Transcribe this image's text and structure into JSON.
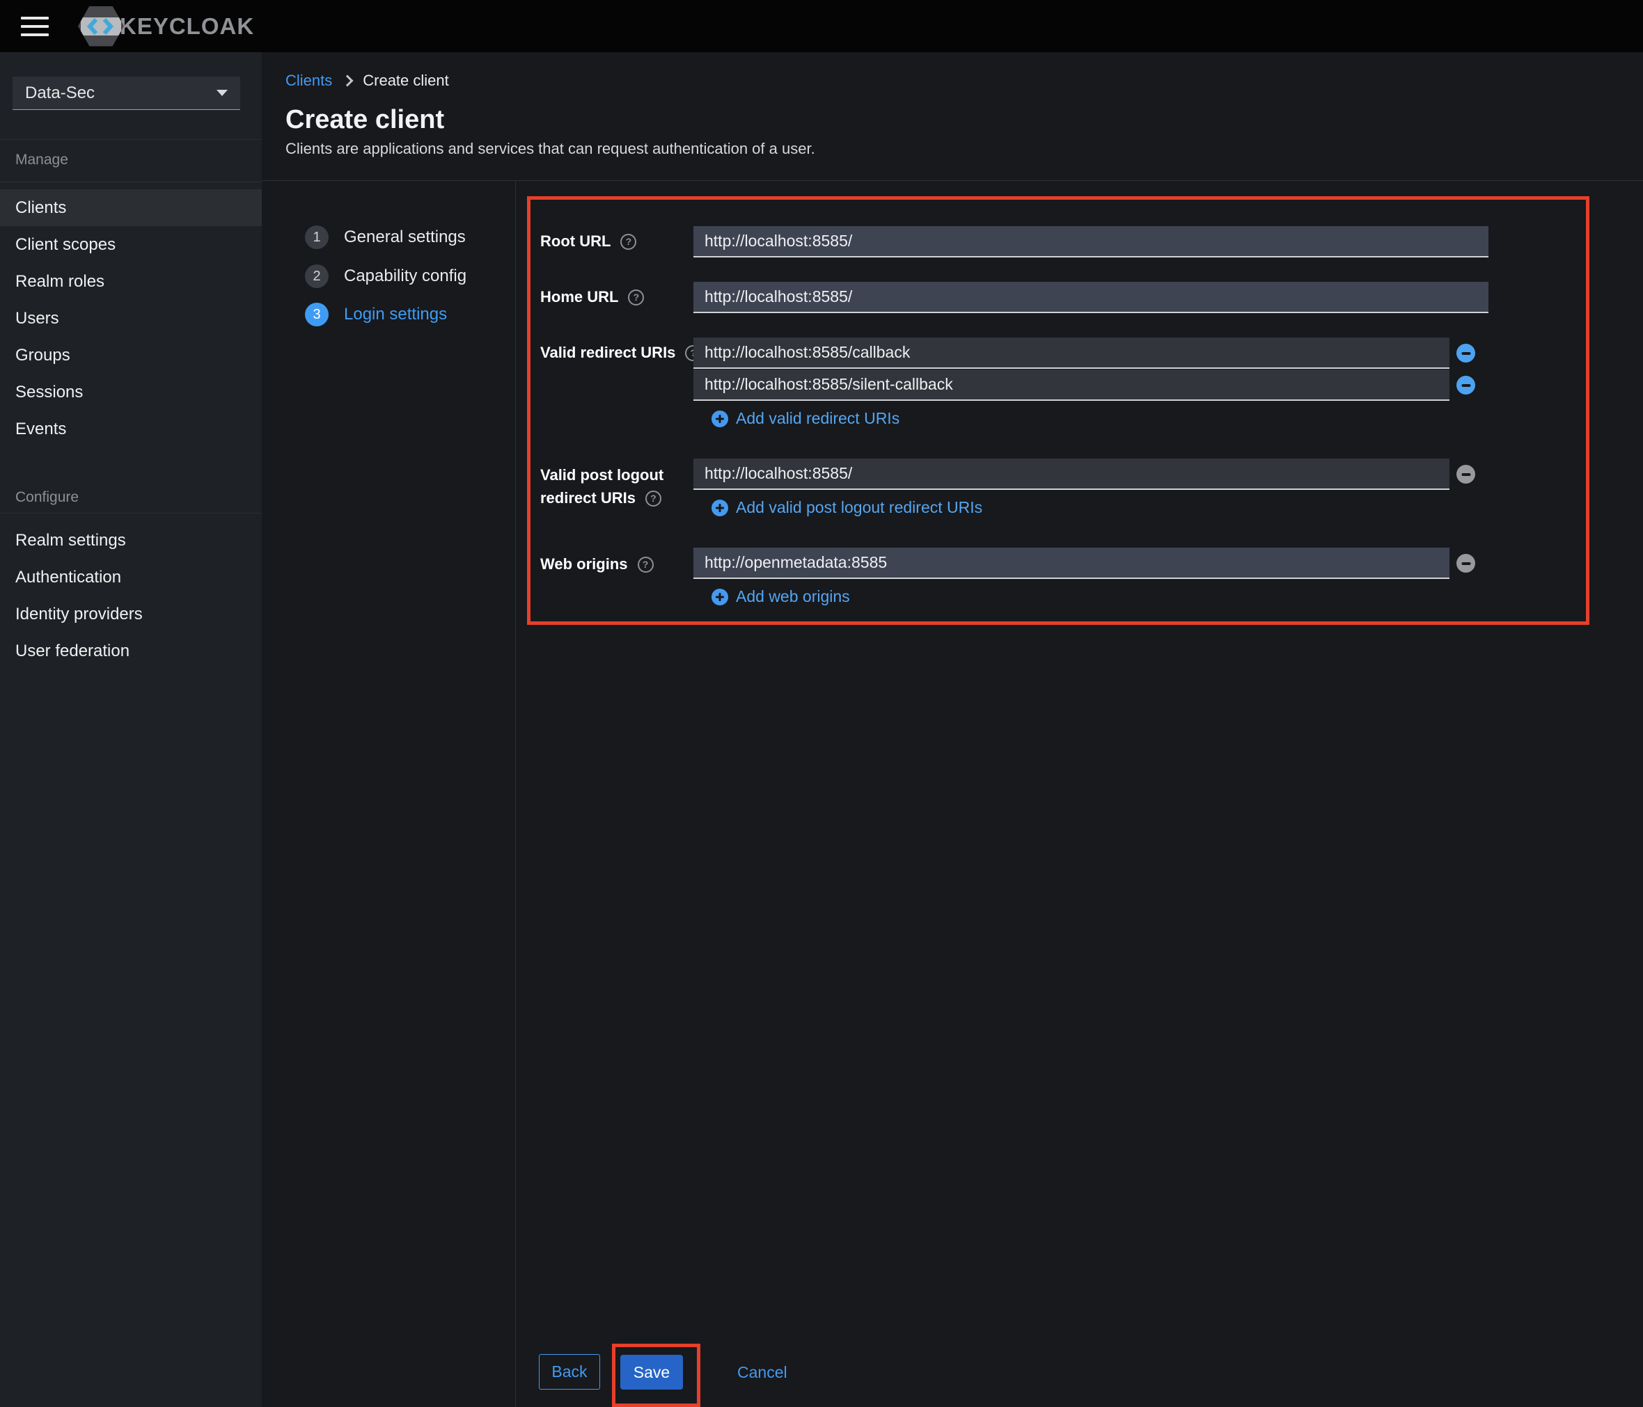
{
  "topbar": {
    "logo_text": "KEYCLOAK"
  },
  "sidebar": {
    "realm": "Data-Sec",
    "manage": {
      "label": "Manage",
      "items": [
        "Clients",
        "Client scopes",
        "Realm roles",
        "Users",
        "Groups",
        "Sessions",
        "Events"
      ]
    },
    "configure": {
      "label": "Configure",
      "items": [
        "Realm settings",
        "Authentication",
        "Identity providers",
        "User federation"
      ]
    },
    "selected_item": "Clients"
  },
  "breadcrumb": {
    "parent": "Clients",
    "current": "Create client"
  },
  "header": {
    "title": "Create client",
    "subtitle": "Clients are applications and services that can request authentication of a user."
  },
  "wizard": {
    "active_step": "3",
    "steps": [
      {
        "num": "1",
        "label": "General settings"
      },
      {
        "num": "2",
        "label": "Capability config"
      },
      {
        "num": "3",
        "label": "Login settings"
      }
    ]
  },
  "form": {
    "root_url": {
      "label": "Root URL",
      "value": "http://localhost:8585/"
    },
    "home_url": {
      "label": "Home URL",
      "value": "http://localhost:8585/"
    },
    "redirect_uris": {
      "label": "Valid redirect URIs",
      "values": [
        "http://localhost:8585/callback",
        "http://localhost:8585/silent-callback"
      ],
      "add_label": "Add valid redirect URIs"
    },
    "post_logout_uris": {
      "label_line1": "Valid post logout",
      "label_line2": "redirect URIs",
      "values": [
        "http://localhost:8585/"
      ],
      "add_label": "Add valid post logout redirect URIs"
    },
    "web_origins": {
      "label": "Web origins",
      "values": [
        "http://openmetadata:8585"
      ],
      "add_label": "Add web origins"
    }
  },
  "actions": {
    "back": "Back",
    "save": "Save",
    "cancel": "Cancel"
  },
  "colors": {
    "accent_blue": "#459af0",
    "active_step_blue": "#3f9cf4",
    "primary_button_blue": "#2665c7",
    "highlight_red": "#e6402a",
    "input_slate": "#3e4452",
    "input_dark": "#32353b"
  }
}
